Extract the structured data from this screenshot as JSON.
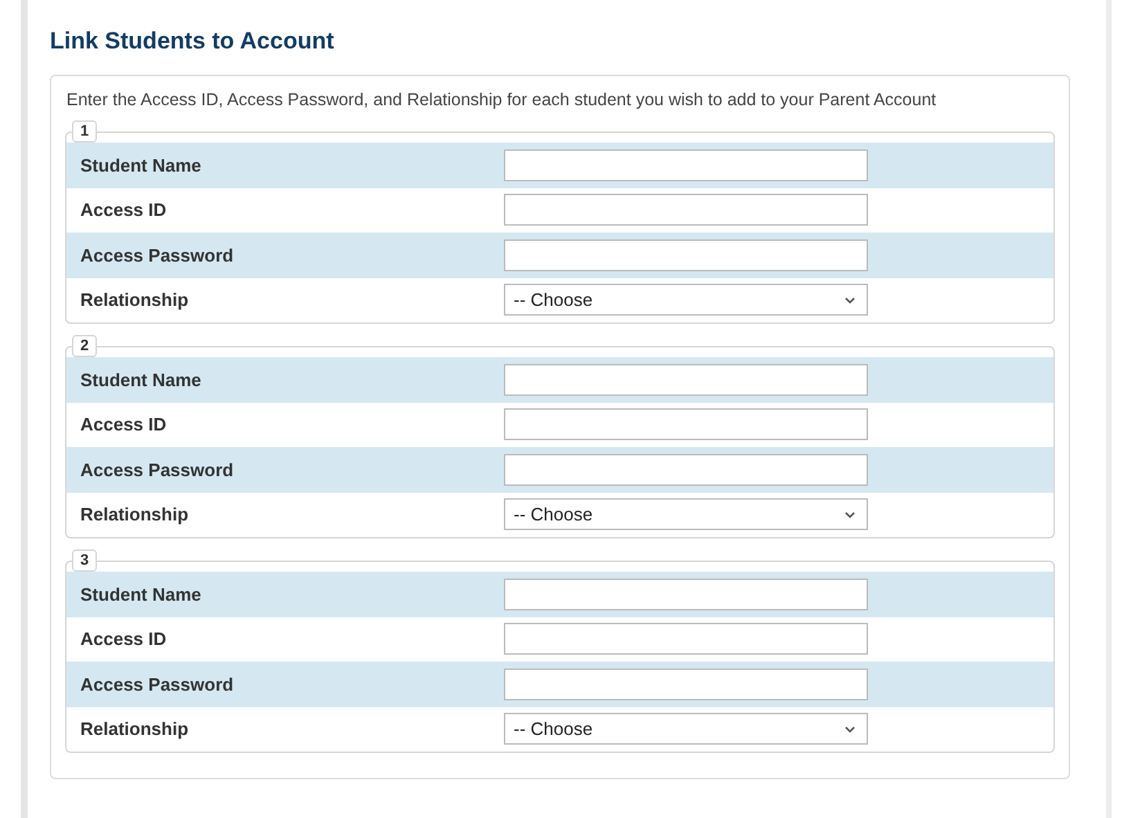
{
  "title": "Link Students to Account",
  "instructions": "Enter the Access ID, Access Password, and Relationship for each student you wish to add to your Parent Account",
  "students": [
    {
      "number": "1",
      "fields": [
        {
          "label": "Student Name",
          "kind": "text"
        },
        {
          "label": "Access ID",
          "kind": "text"
        },
        {
          "label": "Access Password",
          "kind": "text"
        },
        {
          "label": "Relationship",
          "kind": "select",
          "value": "-- Choose"
        }
      ]
    },
    {
      "number": "2",
      "fields": [
        {
          "label": "Student Name",
          "kind": "text"
        },
        {
          "label": "Access ID",
          "kind": "text"
        },
        {
          "label": "Access Password",
          "kind": "text"
        },
        {
          "label": "Relationship",
          "kind": "select",
          "value": "-- Choose"
        }
      ]
    },
    {
      "number": "3",
      "fields": [
        {
          "label": "Student Name",
          "kind": "text"
        },
        {
          "label": "Access ID",
          "kind": "text"
        },
        {
          "label": "Access Password",
          "kind": "text"
        },
        {
          "label": "Relationship",
          "kind": "select",
          "value": "-- Choose"
        }
      ]
    }
  ]
}
